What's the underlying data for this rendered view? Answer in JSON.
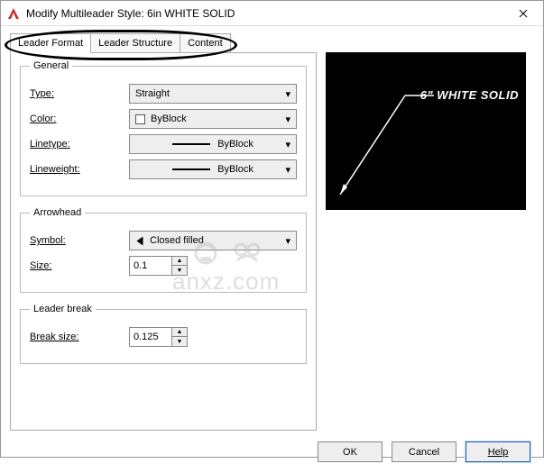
{
  "window": {
    "title": "Modify Multileader Style: 6in WHITE SOLID"
  },
  "tabs": {
    "t0": "Leader Format",
    "t1": "Leader Structure",
    "t2": "Content"
  },
  "general": {
    "legend": "General",
    "type_label": "Type:",
    "type_value": "Straight",
    "color_label": "Color:",
    "color_value": "ByBlock",
    "linetype_label": "Linetype:",
    "linetype_value": "ByBlock",
    "lineweight_label": "Lineweight:",
    "lineweight_value": "ByBlock"
  },
  "arrowhead": {
    "legend": "Arrowhead",
    "symbol_label": "Symbol:",
    "symbol_value": "Closed filled",
    "size_label": "Size:",
    "size_value": "0.1"
  },
  "leaderbreak": {
    "legend": "Leader break",
    "break_label": "Break size:",
    "break_value": "0.125"
  },
  "preview": {
    "text": "6\" WHITE SOLID"
  },
  "buttons": {
    "ok": "OK",
    "cancel": "Cancel",
    "help": "Help"
  },
  "watermark": {
    "text": "anxz.com"
  }
}
